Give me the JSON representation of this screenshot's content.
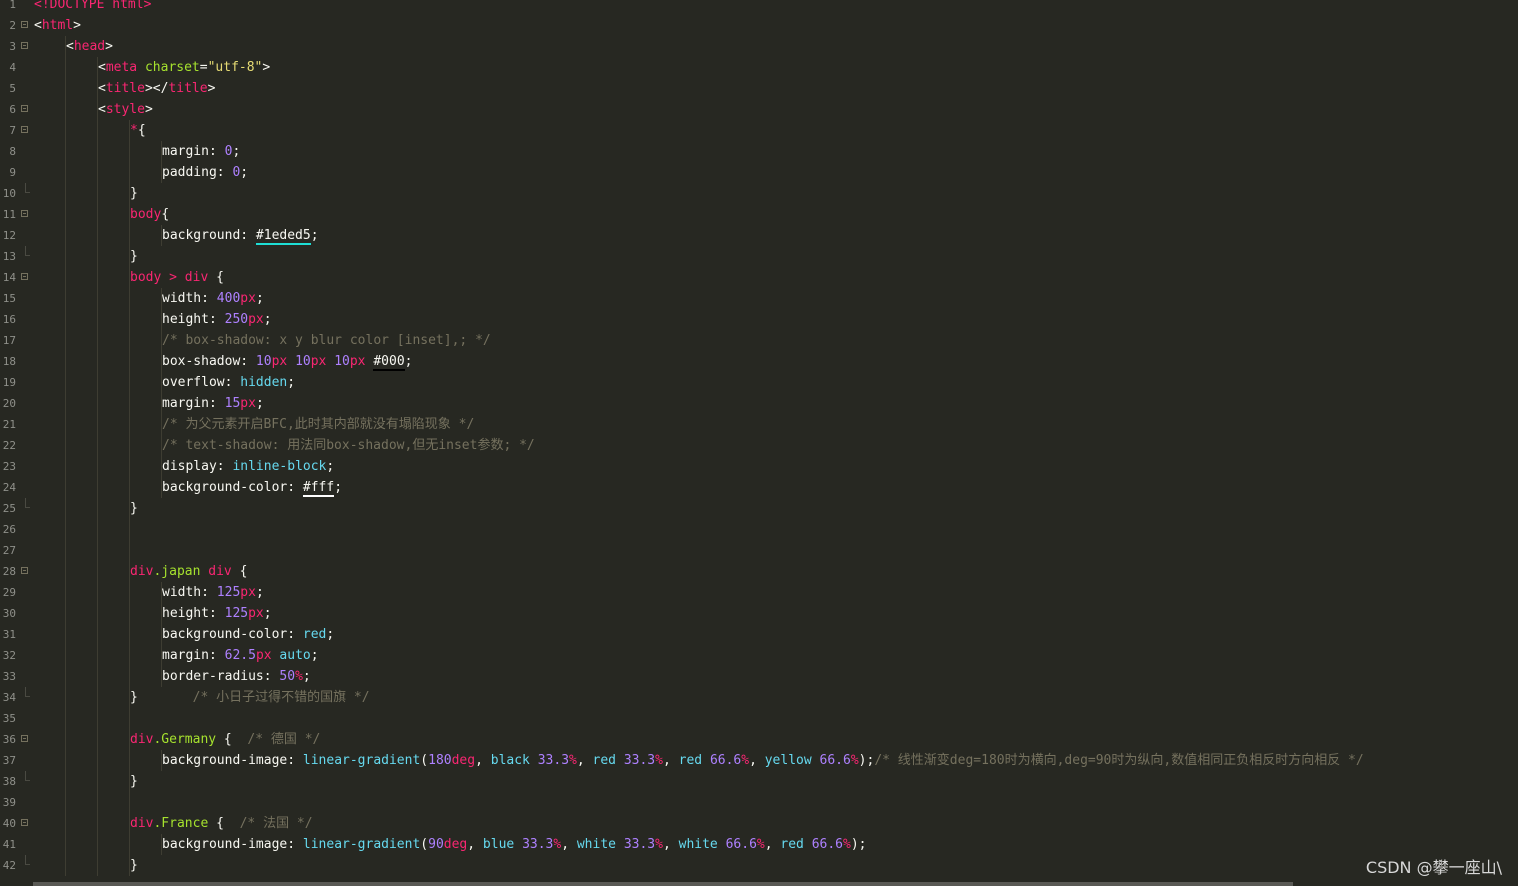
{
  "editor": {
    "theme_colors": {
      "background": "#272822",
      "tag": "#f92672",
      "attribute": "#a6e22e",
      "string": "#e6db74",
      "number": "#ae81ff",
      "keyword": "#66d9ef",
      "comment": "#75715e",
      "text": "#f8f8f2"
    },
    "lines": [
      {
        "n": "1",
        "fold": "",
        "indent": 0,
        "tokens": [
          [
            "tg",
            "<!DOCTYPE html>"
          ]
        ]
      },
      {
        "n": "2",
        "fold": "open",
        "indent": 0,
        "tokens": [
          [
            "wt",
            "<"
          ],
          [
            "tg",
            "html"
          ],
          [
            "wt",
            ">"
          ]
        ]
      },
      {
        "n": "3",
        "fold": "open",
        "indent": 1,
        "tokens": [
          [
            "wt",
            "<"
          ],
          [
            "tg",
            "head"
          ],
          [
            "wt",
            ">"
          ]
        ]
      },
      {
        "n": "4",
        "fold": "",
        "indent": 2,
        "tokens": [
          [
            "wt",
            "<"
          ],
          [
            "tg",
            "meta"
          ],
          [
            "wt",
            " "
          ],
          [
            "at",
            "charset"
          ],
          [
            "wt",
            "="
          ],
          [
            "st",
            "\"utf-8\""
          ],
          [
            "wt",
            ">"
          ]
        ]
      },
      {
        "n": "5",
        "fold": "",
        "indent": 2,
        "tokens": [
          [
            "wt",
            "<"
          ],
          [
            "tg",
            "title"
          ],
          [
            "wt",
            "></"
          ],
          [
            "tg",
            "title"
          ],
          [
            "wt",
            ">"
          ]
        ]
      },
      {
        "n": "6",
        "fold": "open",
        "indent": 2,
        "tokens": [
          [
            "wt",
            "<"
          ],
          [
            "tg",
            "style"
          ],
          [
            "wt",
            ">"
          ]
        ]
      },
      {
        "n": "7",
        "fold": "open",
        "indent": 3,
        "tokens": [
          [
            "tg",
            "*"
          ],
          [
            "wt",
            "{"
          ]
        ]
      },
      {
        "n": "8",
        "fold": "",
        "indent": 4,
        "tokens": [
          [
            "wt",
            "margin: "
          ],
          [
            "nm",
            "0"
          ],
          [
            "wt",
            ";"
          ]
        ]
      },
      {
        "n": "9",
        "fold": "",
        "indent": 4,
        "tokens": [
          [
            "wt",
            "padding: "
          ],
          [
            "nm",
            "0"
          ],
          [
            "wt",
            ";"
          ]
        ]
      },
      {
        "n": "10",
        "fold": "end",
        "indent": 3,
        "tokens": [
          [
            "wt",
            "}"
          ]
        ]
      },
      {
        "n": "11",
        "fold": "open",
        "indent": 3,
        "tokens": [
          [
            "tg",
            "body"
          ],
          [
            "wt",
            "{"
          ]
        ]
      },
      {
        "n": "12",
        "fold": "",
        "indent": 4,
        "tokens": [
          [
            "wt",
            "background: "
          ],
          [
            "hex",
            "#1eded5"
          ],
          [
            "wt",
            ";"
          ]
        ]
      },
      {
        "n": "13",
        "fold": "end",
        "indent": 3,
        "tokens": [
          [
            "wt",
            "}"
          ]
        ]
      },
      {
        "n": "14",
        "fold": "open",
        "indent": 3,
        "tokens": [
          [
            "tg",
            "body"
          ],
          [
            "wt",
            " "
          ],
          [
            "tg",
            ">"
          ],
          [
            "wt",
            " "
          ],
          [
            "tg",
            "div"
          ],
          [
            "wt",
            " {"
          ]
        ]
      },
      {
        "n": "15",
        "fold": "",
        "indent": 4,
        "tokens": [
          [
            "wt",
            "width: "
          ],
          [
            "nm",
            "400"
          ],
          [
            "un",
            "px"
          ],
          [
            "wt",
            ";"
          ]
        ]
      },
      {
        "n": "16",
        "fold": "",
        "indent": 4,
        "tokens": [
          [
            "wt",
            "height: "
          ],
          [
            "nm",
            "250"
          ],
          [
            "un",
            "px"
          ],
          [
            "wt",
            ";"
          ]
        ]
      },
      {
        "n": "17",
        "fold": "",
        "indent": 4,
        "tokens": [
          [
            "cm",
            "/* box-shadow: x y blur color [inset],; */"
          ]
        ]
      },
      {
        "n": "18",
        "fold": "",
        "indent": 4,
        "tokens": [
          [
            "wt",
            "box-shadow: "
          ],
          [
            "nm",
            "10"
          ],
          [
            "un",
            "px"
          ],
          [
            "wt",
            " "
          ],
          [
            "nm",
            "10"
          ],
          [
            "un",
            "px"
          ],
          [
            "wt",
            " "
          ],
          [
            "nm",
            "10"
          ],
          [
            "un",
            "px"
          ],
          [
            "wt",
            " "
          ],
          [
            "hex2",
            "#000"
          ],
          [
            "wt",
            ";"
          ]
        ]
      },
      {
        "n": "19",
        "fold": "",
        "indent": 4,
        "tokens": [
          [
            "wt",
            "overflow: "
          ],
          [
            "kw",
            "hidden"
          ],
          [
            "wt",
            ";"
          ]
        ]
      },
      {
        "n": "20",
        "fold": "",
        "indent": 4,
        "tokens": [
          [
            "wt",
            "margin: "
          ],
          [
            "nm",
            "15"
          ],
          [
            "un",
            "px"
          ],
          [
            "wt",
            ";"
          ]
        ]
      },
      {
        "n": "21",
        "fold": "",
        "indent": 4,
        "tokens": [
          [
            "cm",
            "/* 为父元素开启BFC,此时其内部就没有塌陷现象 */"
          ]
        ]
      },
      {
        "n": "22",
        "fold": "",
        "indent": 4,
        "tokens": [
          [
            "cm",
            "/* text-shadow: 用法同box-shadow,但无inset参数; */"
          ]
        ]
      },
      {
        "n": "23",
        "fold": "",
        "indent": 4,
        "tokens": [
          [
            "wt",
            "display: "
          ],
          [
            "kw",
            "inline-block"
          ],
          [
            "wt",
            ";"
          ]
        ]
      },
      {
        "n": "24",
        "fold": "",
        "indent": 4,
        "tokens": [
          [
            "wt",
            "background-color: "
          ],
          [
            "hex3",
            "#fff"
          ],
          [
            "wt",
            ";"
          ]
        ]
      },
      {
        "n": "25",
        "fold": "end",
        "indent": 3,
        "tokens": [
          [
            "wt",
            "}"
          ]
        ]
      },
      {
        "n": "26",
        "fold": "",
        "indent": 3,
        "tokens": []
      },
      {
        "n": "27",
        "fold": "",
        "indent": 3,
        "tokens": []
      },
      {
        "n": "28",
        "fold": "open",
        "indent": 3,
        "tokens": [
          [
            "tg",
            "div"
          ],
          [
            "at",
            ".japan"
          ],
          [
            "wt",
            " "
          ],
          [
            "tg",
            "div"
          ],
          [
            "wt",
            " {"
          ]
        ]
      },
      {
        "n": "29",
        "fold": "",
        "indent": 4,
        "tokens": [
          [
            "wt",
            "width: "
          ],
          [
            "nm",
            "125"
          ],
          [
            "un",
            "px"
          ],
          [
            "wt",
            ";"
          ]
        ]
      },
      {
        "n": "30",
        "fold": "",
        "indent": 4,
        "tokens": [
          [
            "wt",
            "height: "
          ],
          [
            "nm",
            "125"
          ],
          [
            "un",
            "px"
          ],
          [
            "wt",
            ";"
          ]
        ]
      },
      {
        "n": "31",
        "fold": "",
        "indent": 4,
        "tokens": [
          [
            "wt",
            "background-color: "
          ],
          [
            "kw",
            "red"
          ],
          [
            "wt",
            ";"
          ]
        ]
      },
      {
        "n": "32",
        "fold": "",
        "indent": 4,
        "tokens": [
          [
            "wt",
            "margin: "
          ],
          [
            "nm",
            "62.5"
          ],
          [
            "un",
            "px"
          ],
          [
            "wt",
            " "
          ],
          [
            "kw",
            "auto"
          ],
          [
            "wt",
            ";"
          ]
        ]
      },
      {
        "n": "33",
        "fold": "",
        "indent": 4,
        "tokens": [
          [
            "wt",
            "border-radius: "
          ],
          [
            "nm",
            "50"
          ],
          [
            "un",
            "%"
          ],
          [
            "wt",
            ";"
          ]
        ]
      },
      {
        "n": "34",
        "fold": "end",
        "indent": 3,
        "tokens": [
          [
            "wt",
            "}       "
          ],
          [
            "cm",
            "/* 小日子过得不错的国旗 */"
          ]
        ]
      },
      {
        "n": "35",
        "fold": "",
        "indent": 3,
        "tokens": []
      },
      {
        "n": "36",
        "fold": "open",
        "indent": 3,
        "tokens": [
          [
            "tg",
            "div"
          ],
          [
            "at",
            ".Germany"
          ],
          [
            "wt",
            " {  "
          ],
          [
            "cm",
            "/* 德国 */"
          ]
        ]
      },
      {
        "n": "37",
        "fold": "",
        "indent": 4,
        "tokens": [
          [
            "wt",
            "background-image: "
          ],
          [
            "kw",
            "linear-gradient"
          ],
          [
            "wt",
            "("
          ],
          [
            "nm",
            "180"
          ],
          [
            "un",
            "deg"
          ],
          [
            "wt",
            ", "
          ],
          [
            "kw",
            "black"
          ],
          [
            "wt",
            " "
          ],
          [
            "nm",
            "33.3"
          ],
          [
            "un",
            "%"
          ],
          [
            "wt",
            ", "
          ],
          [
            "kw",
            "red"
          ],
          [
            "wt",
            " "
          ],
          [
            "nm",
            "33.3"
          ],
          [
            "un",
            "%"
          ],
          [
            "wt",
            ", "
          ],
          [
            "kw",
            "red"
          ],
          [
            "wt",
            " "
          ],
          [
            "nm",
            "66.6"
          ],
          [
            "un",
            "%"
          ],
          [
            "wt",
            ", "
          ],
          [
            "kw",
            "yellow"
          ],
          [
            "wt",
            " "
          ],
          [
            "nm",
            "66.6"
          ],
          [
            "un",
            "%"
          ],
          [
            "wt",
            ");"
          ],
          [
            "cm",
            "/* 线性渐变deg=180时为横向,deg=90时为纵向,数值相同正负相反时方向相反 */"
          ]
        ]
      },
      {
        "n": "38",
        "fold": "end",
        "indent": 3,
        "tokens": [
          [
            "wt",
            "}"
          ]
        ]
      },
      {
        "n": "39",
        "fold": "",
        "indent": 3,
        "tokens": []
      },
      {
        "n": "40",
        "fold": "open",
        "indent": 3,
        "tokens": [
          [
            "tg",
            "div"
          ],
          [
            "at",
            ".France"
          ],
          [
            "wt",
            " {  "
          ],
          [
            "cm",
            "/* 法国 */"
          ]
        ]
      },
      {
        "n": "41",
        "fold": "",
        "indent": 4,
        "tokens": [
          [
            "wt",
            "background-image: "
          ],
          [
            "kw",
            "linear-gradient"
          ],
          [
            "wt",
            "("
          ],
          [
            "nm",
            "90"
          ],
          [
            "un",
            "deg"
          ],
          [
            "wt",
            ", "
          ],
          [
            "kw",
            "blue"
          ],
          [
            "wt",
            " "
          ],
          [
            "nm",
            "33.3"
          ],
          [
            "un",
            "%"
          ],
          [
            "wt",
            ", "
          ],
          [
            "kw",
            "white"
          ],
          [
            "wt",
            " "
          ],
          [
            "nm",
            "33.3"
          ],
          [
            "un",
            "%"
          ],
          [
            "wt",
            ", "
          ],
          [
            "kw",
            "white"
          ],
          [
            "wt",
            " "
          ],
          [
            "nm",
            "66.6"
          ],
          [
            "un",
            "%"
          ],
          [
            "wt",
            ", "
          ],
          [
            "kw",
            "red"
          ],
          [
            "wt",
            " "
          ],
          [
            "nm",
            "66.6"
          ],
          [
            "un",
            "%"
          ],
          [
            "wt",
            ");"
          ]
        ]
      },
      {
        "n": "42",
        "fold": "end",
        "indent": 3,
        "tokens": [
          [
            "wt",
            "}"
          ]
        ]
      }
    ]
  },
  "watermark": "CSDN @攀一座山\\"
}
